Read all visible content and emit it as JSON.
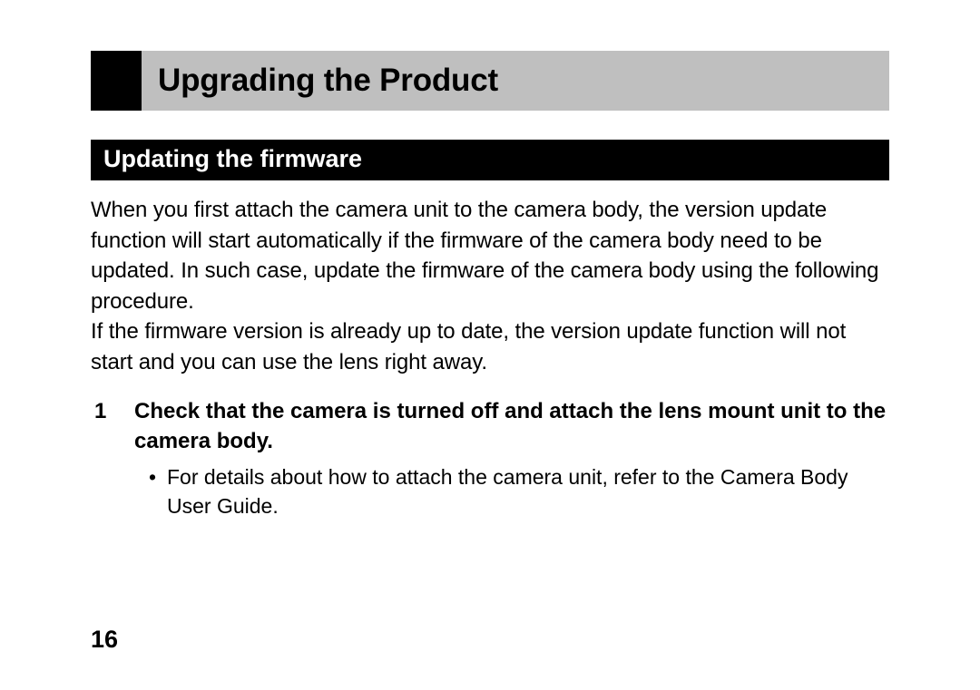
{
  "header": {
    "title": "Upgrading the Product"
  },
  "section": {
    "title": "Updating the firmware",
    "para1": "When you first attach the camera unit to the camera body, the version update function will start automatically if the firmware of the camera body need to be updated. In such case, update the firmware of the camera body using the following procedure.",
    "para2": "If the firmware version is already up to date, the version update function will not start and you can use the lens right away."
  },
  "step": {
    "number": "1",
    "text": "Check that the camera is turned off and attach the lens mount unit to the camera body.",
    "bullet": "For details about how to attach the camera unit, refer to the Camera Body User Guide."
  },
  "pageNumber": "16",
  "glyphs": {
    "bullet": "•"
  }
}
